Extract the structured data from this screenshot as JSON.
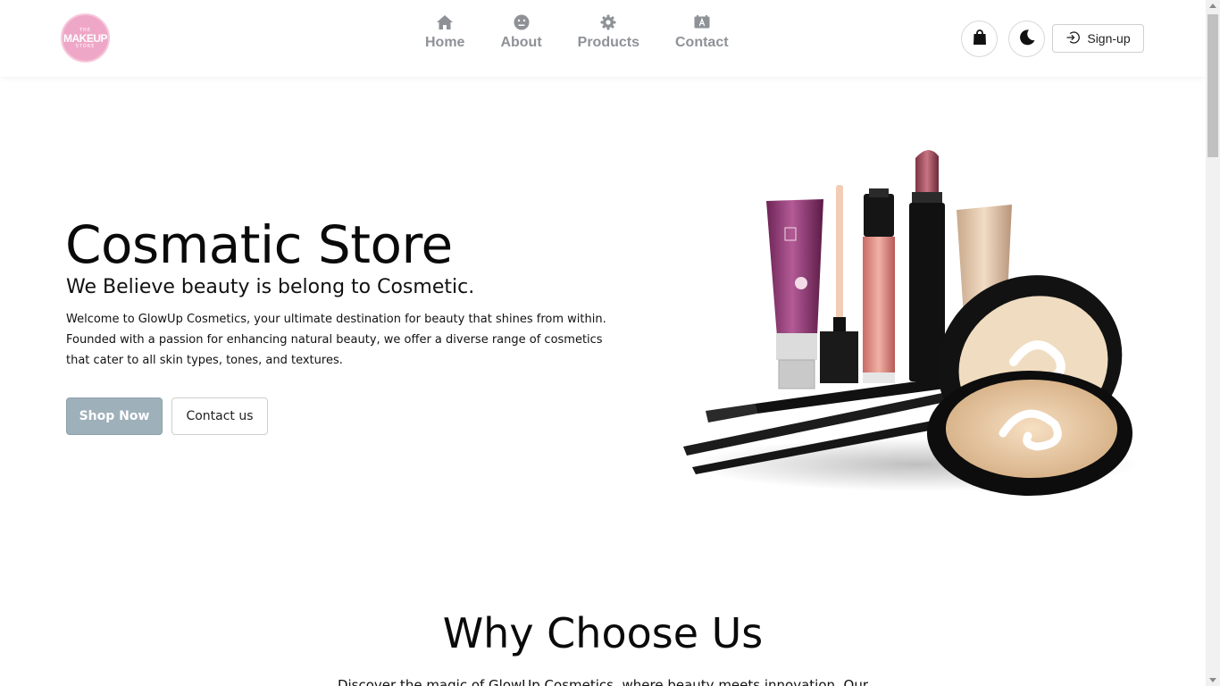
{
  "brand": {
    "logo_top": "THE",
    "logo_main": "MAKEUP",
    "logo_bottom": "STORE"
  },
  "nav": {
    "items": [
      {
        "label": "Home",
        "icon": "home-icon"
      },
      {
        "label": "About",
        "icon": "face-icon"
      },
      {
        "label": "Products",
        "icon": "gear-icon"
      },
      {
        "label": "Contact",
        "icon": "contact-card-icon"
      }
    ],
    "icon_color": "#8e9297"
  },
  "header_actions": {
    "cart_icon": "shopping-bag-icon",
    "theme_icon": "moon-icon",
    "signup_label": "Sign-up",
    "signup_icon": "sign-in-icon"
  },
  "hero": {
    "title": "Cosmatic Store",
    "subtitle": "We Believe beauty is belong to Cosmetic.",
    "description": "Welcome to GlowUp Cosmetics, your ultimate destination for beauty that shines from within. Founded with a passion for enhancing natural beauty, we offer a diverse range of cosmetics that cater to all skin types, tones, and textures.",
    "primary_button": "Shop Now",
    "secondary_button": "Contact us",
    "primary_color": "#9eb0ba"
  },
  "why": {
    "title": "Why Choose Us",
    "description": "Discover the magic of GlowUp Cosmetics, where beauty meets innovation. Our"
  }
}
